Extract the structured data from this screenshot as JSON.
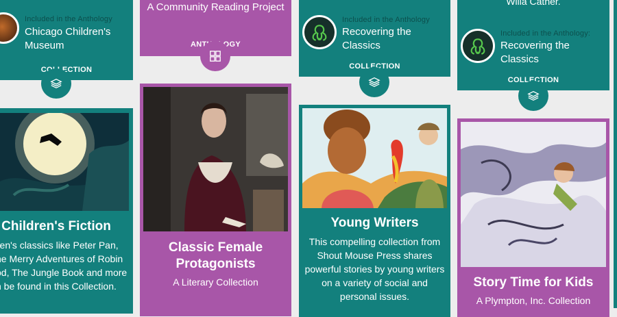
{
  "colors": {
    "teal": "#13807d",
    "purple": "#a856a8",
    "background": "#ededed"
  },
  "cards": {
    "chicago": {
      "included_label": "Included in the Anthology",
      "title_line1": "Chicago Children's",
      "title_line2": "Museum",
      "type_label": "COLLECTION",
      "icon": "layers-icon"
    },
    "reading_project": {
      "subtitle": "A Community Reading Project",
      "type_label": "ANTHOLOGY",
      "icon": "grid-icon"
    },
    "recovering_1": {
      "included_label": "Included in the Anthology",
      "title": "Recovering the Classics",
      "type_label": "COLLECTION",
      "icon": "layers-icon"
    },
    "recovering_2": {
      "top_text": "Willa Cather.",
      "included_label": "Included in the Anthology:",
      "title": "Recovering the Classics",
      "type_label": "COLLECTION",
      "icon": "layers-icon"
    },
    "childrens_fiction": {
      "title": "Children's Fiction",
      "desc_line1": "ldren's classics like Peter Pan,",
      "desc_line2": "he Merry Adventures of Robin",
      "desc_line3": "od, The Jungle Book and more",
      "desc_line4": "n be found in this Collection."
    },
    "classic_female": {
      "title_line1": "Classic Female",
      "title_line2": "Protagonists",
      "subtitle": "A Literary Collection"
    },
    "young_writers": {
      "title": "Young Writers",
      "desc_line1": "This compelling collection from",
      "desc_line2": "Shout Mouse Press shares",
      "desc_line3": "powerful stories by young writers",
      "desc_line4": "on a variety of social and",
      "desc_line5": "personal issues."
    },
    "story_time": {
      "title": "Story Time for Kids",
      "subtitle": "A Plympton, Inc. Collection"
    }
  }
}
